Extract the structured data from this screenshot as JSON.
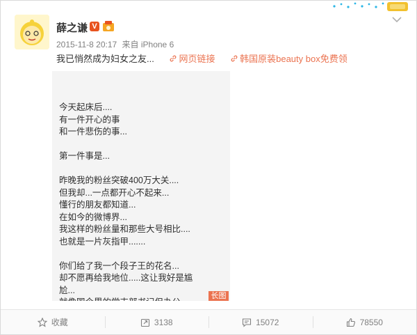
{
  "user": {
    "name": "薛之谦",
    "verified_badge": "V"
  },
  "meta": {
    "time": "2015-11-8 20:17",
    "source": "来自 iPhone 6"
  },
  "post": {
    "text": "我已悄然成为妇女之友...",
    "links": [
      "网页链接",
      "韩国原装beauty box免费领"
    ]
  },
  "long_image": {
    "lines": [
      "今天起床后....",
      "有一件开心的事",
      "和一件悲伤的事...",
      "",
      "第一件事是...",
      "",
      "昨晚我的粉丝突破400万大关....",
      "但我却...一点都开心不起来...",
      "懂行的朋友都知道...",
      "在如今的微博界...",
      "我这样的粉丝量和那些大号相比....",
      "也就是一片灰指甲.......",
      "",
      "你们给了我一个段子王的花名...",
      "却不愿再给我地位.....这让我好是尴",
      "尬...",
      "就像国企里的党支部书记但办公"
    ],
    "badge": "长图"
  },
  "toolbar": {
    "favorite": "收藏",
    "repost": "3138",
    "comment": "15072",
    "like": "78550"
  },
  "colors": {
    "accent": "#eb7350",
    "text": "#333333",
    "muted": "#808080"
  }
}
